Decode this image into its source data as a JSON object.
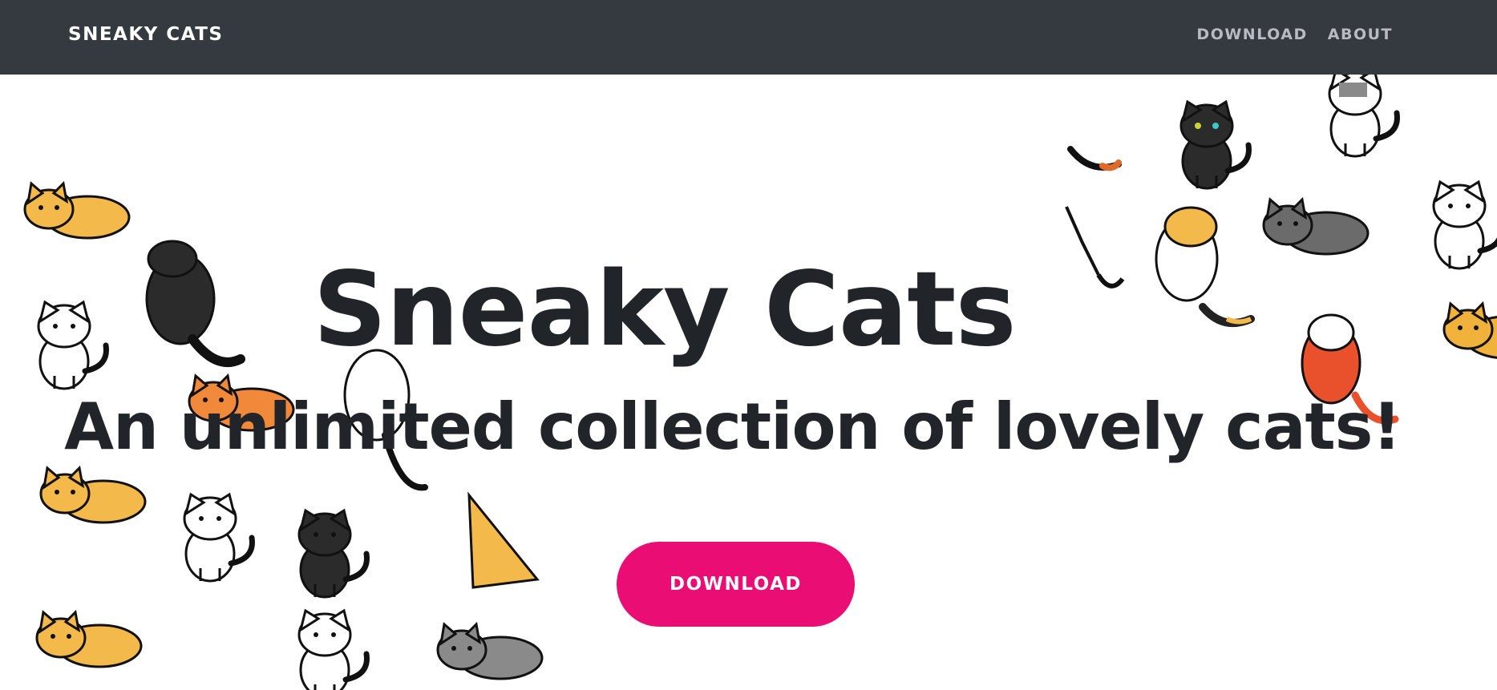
{
  "navbar": {
    "brand": "SNEAKY CATS",
    "links": [
      {
        "label": "DOWNLOAD"
      },
      {
        "label": "ABOUT"
      }
    ]
  },
  "hero": {
    "title": "Sneaky Cats",
    "subtitle": "An unlimited collection of lovely cats!",
    "cta_label": "DOWNLOAD",
    "cta_color": "#ea0d73",
    "navbar_color": "#343a40"
  }
}
